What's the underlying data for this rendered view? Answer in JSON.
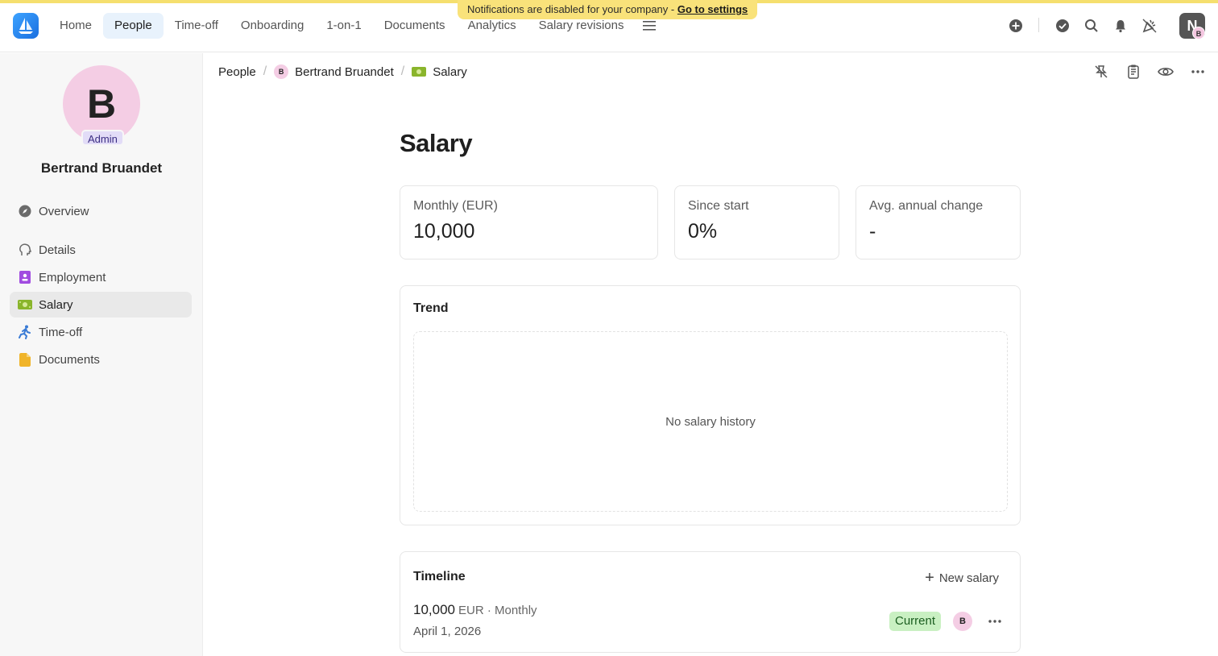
{
  "banner": {
    "text": "Notifications are disabled for your company - ",
    "link": "Go to settings"
  },
  "nav": {
    "items": [
      "Home",
      "People",
      "Time-off",
      "Onboarding",
      "1-on-1",
      "Documents",
      "Analytics",
      "Salary revisions"
    ],
    "active": "People"
  },
  "user": {
    "initial": "N",
    "mini_initial": "B"
  },
  "profile": {
    "initial": "B",
    "role": "Admin",
    "name": "Bertrand Bruandet"
  },
  "sidebar": {
    "items": [
      {
        "label": "Overview",
        "icon": "compass-icon"
      },
      {
        "label": "Details",
        "icon": "profile-head-icon"
      },
      {
        "label": "Employment",
        "icon": "id-badge-icon"
      },
      {
        "label": "Salary",
        "icon": "money-icon"
      },
      {
        "label": "Time-off",
        "icon": "running-person-icon"
      },
      {
        "label": "Documents",
        "icon": "document-icon"
      }
    ],
    "active": "Salary"
  },
  "breadcrumb": {
    "root": "People",
    "person_initial": "B",
    "person": "Bertrand Bruandet",
    "page": "Salary"
  },
  "page": {
    "title": "Salary",
    "stats": [
      {
        "label": "Monthly (EUR)",
        "value": "10,000"
      },
      {
        "label": "Since start",
        "value": "0%"
      },
      {
        "label": "Avg. annual change",
        "value": "-"
      }
    ],
    "trend": {
      "title": "Trend",
      "empty_text": "No salary history"
    },
    "timeline": {
      "title": "Timeline",
      "new_button": "New salary",
      "entry": {
        "amount": "10,000",
        "meta": "EUR · Monthly",
        "date": "April 1, 2026",
        "status": "Current",
        "author_initial": "B"
      }
    }
  },
  "colors": {
    "accent": "#1a6fe0",
    "banner": "#f9e27a",
    "current_badge": "#c9f0c2"
  }
}
